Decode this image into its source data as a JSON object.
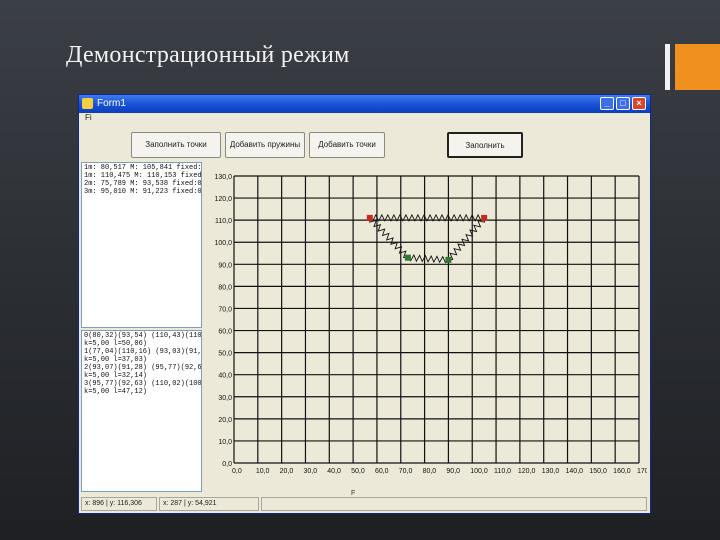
{
  "slide": {
    "title": "Демонстрационный режим"
  },
  "window": {
    "title": "Form1",
    "controls": {
      "minimize": "_",
      "maximize": "□",
      "close": "×"
    },
    "menu": [
      "Fi"
    ]
  },
  "toolbar": {
    "buttons": [
      "Заполнить точки",
      "Добавить пружины",
      "Добавить точки",
      "Заполнить"
    ]
  },
  "points_list": [
    "1m: 80,517 M: 105,841 fixed:1",
    "1m: 110,475 M: 110,153 fixed:1",
    "2m: 75,789 M: 93,538 fixed:0",
    "3m: 95,010 M: 91,223 fixed:0"
  ],
  "springs_list": [
    "0(80,32)(93,54) (110,43)(110,16)",
    "k=5,00 l=50,06)",
    "1(77,04)(110,16) (93,03)(91,28)",
    "k=5,00 l=37,03)",
    "2(93,07)(91,28) (95,77)(92,63)",
    "k=5,00 l=32,14)",
    "3(95,77)(92,63) (110,02)(100,04)",
    "k=5,00 l=47,12)"
  ],
  "statusbar": {
    "left": "x: 896 | y: 116,306",
    "right": "x: 287 | y: 54,921"
  },
  "plot": {
    "x_axis_caption": "F",
    "x_ticks": [
      "0,0",
      "10,0",
      "20,0",
      "30,0",
      "40,0",
      "50,0",
      "60,0",
      "70,0",
      "80,0",
      "90,0",
      "100,0",
      "110,0",
      "120,0",
      "130,0",
      "140,0",
      "150,0",
      "160,0",
      "170,0"
    ],
    "y_ticks": [
      "0,0",
      "10,0",
      "20,0",
      "30,0",
      "40,0",
      "50,0",
      "60,0",
      "70,0",
      "80,0",
      "90,0",
      "100,0",
      "110,0",
      "120,0",
      "130,0"
    ],
    "xlim": [
      0,
      170
    ],
    "ylim": [
      0,
      130
    ],
    "fixed_points": [
      [
        57,
        111
      ],
      [
        105,
        111
      ]
    ],
    "free_points": [
      [
        73,
        93
      ],
      [
        90,
        92
      ]
    ],
    "springs": [
      [
        [
          57,
          111
        ],
        [
          73,
          93
        ]
      ],
      [
        [
          73,
          93
        ],
        [
          90,
          92
        ]
      ],
      [
        [
          90,
          92
        ],
        [
          105,
          111
        ]
      ],
      [
        [
          57,
          111
        ],
        [
          105,
          111
        ]
      ]
    ],
    "colors": {
      "fixed": "#c8281e",
      "free": "#2d7a2d",
      "grid": "#111111",
      "spring": "#111111"
    }
  }
}
